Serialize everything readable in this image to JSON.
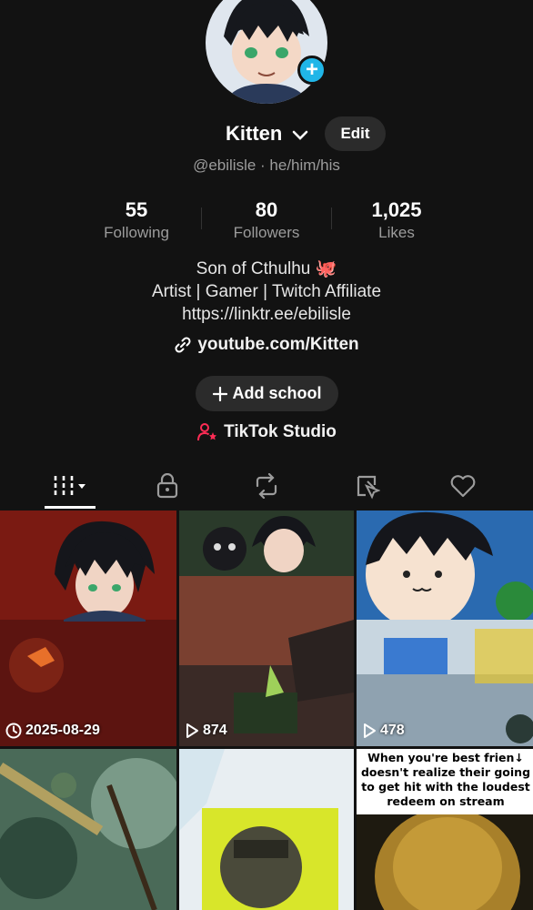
{
  "profile": {
    "display_name": "Kitten",
    "handle_line": "@ebilisle · he/him/his",
    "edit_label": "Edit"
  },
  "stats": [
    {
      "value": "55",
      "label": "Following"
    },
    {
      "value": "80",
      "label": "Followers"
    },
    {
      "value": "1,025",
      "label": "Likes"
    }
  ],
  "bio": {
    "line1": "Son of Cthulhu 🐙",
    "line2": "Artist | Gamer | Twitch Affiliate",
    "line3": "https://linktr.ee/ebilisle",
    "link": "youtube.com/Kitten"
  },
  "actions": {
    "add_school": "Add school",
    "studio": "TikTok Studio"
  },
  "tabs": [
    {
      "icon": "grid-icon",
      "active": true
    },
    {
      "icon": "lock-icon"
    },
    {
      "icon": "repost-icon"
    },
    {
      "icon": "tagged-icon"
    },
    {
      "icon": "heart-icon"
    }
  ],
  "videos": [
    {
      "meta_icon": "clock-icon",
      "meta": "2025-08-29"
    },
    {
      "meta_icon": "play-icon",
      "meta": "874"
    },
    {
      "meta_icon": "play-icon",
      "meta": "478"
    },
    {
      "meta_icon": "",
      "meta": ""
    },
    {
      "meta_icon": "",
      "meta": ""
    },
    {
      "meta_icon": "",
      "meta": "",
      "caption": "When you're best frien↓ doesn't realize their going to get hit with the loudest redeem on stream"
    }
  ],
  "colors": {
    "background": "#121212",
    "accent_blue": "#20b6e8",
    "studio_pink": "#fe2c55",
    "muted_text": "#9c9c9c"
  }
}
